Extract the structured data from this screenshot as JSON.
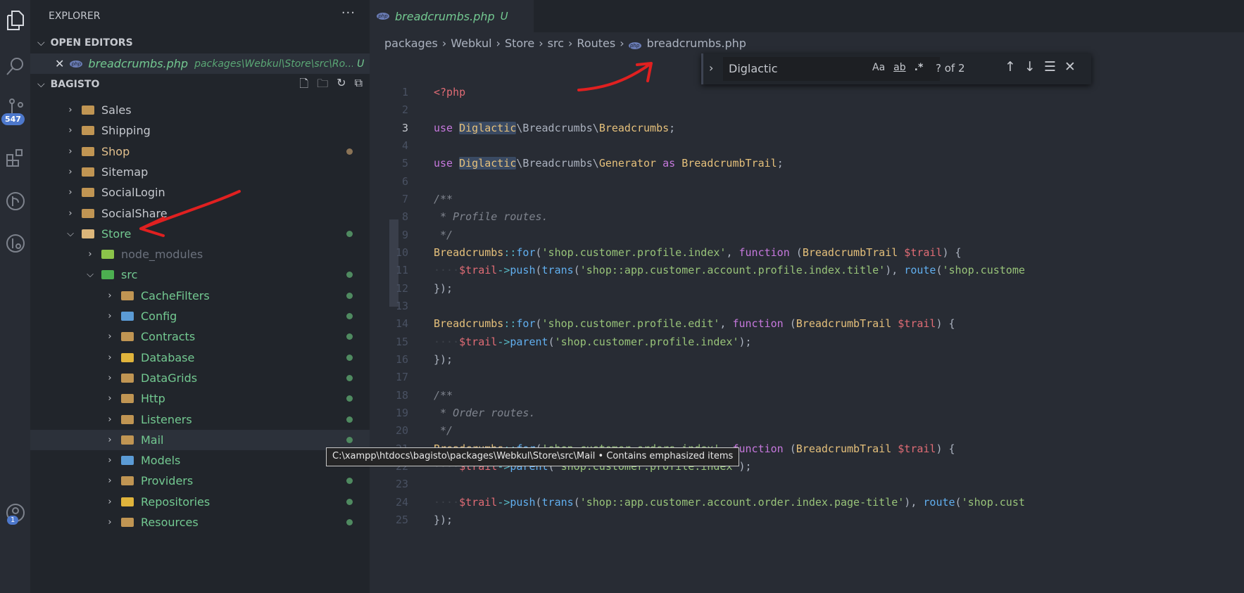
{
  "activity_bar": {
    "items": [
      "files-icon",
      "search-icon",
      "source-control-icon",
      "extensions-icon",
      "git-graph-icon",
      "pull-request-icon",
      "account-icon"
    ],
    "scm_badge": "547",
    "account_badge": "1",
    "accent": "#4d78cc"
  },
  "sidebar": {
    "title": "EXPLORER",
    "more": "···",
    "open_editors": {
      "label": "OPEN EDITORS",
      "file": "breadcrumbs.php",
      "path": "packages\\Webkul\\Store\\src\\Ro...",
      "status": "U"
    },
    "workspace": {
      "label": "BAGISTO",
      "actions": [
        "new-file-icon",
        "new-folder-icon",
        "refresh-icon",
        "collapse-all-icon"
      ]
    },
    "tree": [
      {
        "label": "Sales",
        "level": 0,
        "expanded": false,
        "color": "#c5c8ce",
        "icon": "folder-icon"
      },
      {
        "label": "Shipping",
        "level": 0,
        "expanded": false,
        "color": "#c5c8ce",
        "icon": "folder-icon"
      },
      {
        "label": "Shop",
        "level": 0,
        "expanded": false,
        "color": "#e2c08d",
        "icon": "folder-icon",
        "dot": "#8a7356"
      },
      {
        "label": "Sitemap",
        "level": 0,
        "expanded": false,
        "color": "#c5c8ce",
        "icon": "folder-icon"
      },
      {
        "label": "SocialLogin",
        "level": 0,
        "expanded": false,
        "color": "#c5c8ce",
        "icon": "folder-icon"
      },
      {
        "label": "SocialShare",
        "level": 0,
        "expanded": false,
        "color": "#c5c8ce",
        "icon": "folder-icon"
      },
      {
        "label": "Store",
        "level": 0,
        "expanded": true,
        "color": "#73c991",
        "icon": "folder-open-icon",
        "dot": "#4f8a60"
      },
      {
        "label": "node_modules",
        "level": 1,
        "expanded": false,
        "color": "#6b717d",
        "icon": "node-folder-icon",
        "folder": "#8bc34a"
      },
      {
        "label": "src",
        "level": 1,
        "expanded": true,
        "color": "#73c991",
        "icon": "src-folder-icon",
        "dot": "#4f8a60",
        "folder": "#4caf50"
      },
      {
        "label": "CacheFilters",
        "level": 2,
        "expanded": false,
        "color": "#73c991",
        "icon": "folder-icon",
        "dot": "#4f8a60"
      },
      {
        "label": "Config",
        "level": 2,
        "expanded": false,
        "color": "#73c991",
        "icon": "config-folder-icon",
        "dot": "#4f8a60",
        "folder": "#5b9bd5"
      },
      {
        "label": "Contracts",
        "level": 2,
        "expanded": false,
        "color": "#73c991",
        "icon": "folder-icon",
        "dot": "#4f8a60"
      },
      {
        "label": "Database",
        "level": 2,
        "expanded": false,
        "color": "#73c991",
        "icon": "database-folder-icon",
        "dot": "#4f8a60",
        "folder": "#e0b43c"
      },
      {
        "label": "DataGrids",
        "level": 2,
        "expanded": false,
        "color": "#73c991",
        "icon": "folder-icon",
        "dot": "#4f8a60"
      },
      {
        "label": "Http",
        "level": 2,
        "expanded": false,
        "color": "#73c991",
        "icon": "folder-icon",
        "dot": "#4f8a60"
      },
      {
        "label": "Listeners",
        "level": 2,
        "expanded": false,
        "color": "#73c991",
        "icon": "folder-icon",
        "dot": "#4f8a60"
      },
      {
        "label": "Mail",
        "level": 2,
        "expanded": false,
        "color": "#73c991",
        "icon": "folder-icon",
        "dot": "#4f8a60",
        "hover": true
      },
      {
        "label": "Models",
        "level": 2,
        "expanded": false,
        "color": "#73c991",
        "icon": "models-folder-icon",
        "dot": "#4f8a60",
        "folder": "#5b9bd5"
      },
      {
        "label": "Providers",
        "level": 2,
        "expanded": false,
        "color": "#73c991",
        "icon": "folder-icon",
        "dot": "#4f8a60"
      },
      {
        "label": "Repositories",
        "level": 2,
        "expanded": false,
        "color": "#73c991",
        "icon": "repository-folder-icon",
        "dot": "#4f8a60",
        "folder": "#e0b43c"
      },
      {
        "label": "Resources",
        "level": 2,
        "expanded": false,
        "color": "#73c991",
        "icon": "folder-icon",
        "dot": "#4f8a60"
      }
    ]
  },
  "editor": {
    "tab": {
      "label": "breadcrumbs.php",
      "status": "U"
    },
    "breadcrumb": [
      "packages",
      "Webkul",
      "Store",
      "src",
      "Routes",
      "breadcrumbs.php"
    ],
    "find": {
      "value": "Diglactic",
      "match_case": "Aa",
      "whole_word": "ab",
      "regex": ".*",
      "count": "? of 2"
    },
    "current_line": 3,
    "lines": [
      [
        [
          "v",
          "<?php"
        ]
      ],
      [],
      [
        [
          "k",
          "use "
        ],
        [
          "c match",
          "Diglactic"
        ],
        [
          "p",
          "\\Breadcrumbs\\"
        ],
        [
          "c",
          "Breadcrumbs"
        ],
        [
          "p",
          ";"
        ]
      ],
      [],
      [
        [
          "k",
          "use "
        ],
        [
          "c match",
          "Diglactic"
        ],
        [
          "p",
          "\\Breadcrumbs\\"
        ],
        [
          "c",
          "Generator"
        ],
        [
          "k",
          " as "
        ],
        [
          "c",
          "BreadcrumbTrail"
        ],
        [
          "p",
          ";"
        ]
      ],
      [],
      [
        [
          "cm",
          "/**"
        ]
      ],
      [
        [
          "cm",
          " * Profile routes."
        ]
      ],
      [
        [
          "cm",
          " */"
        ]
      ],
      [
        [
          "c",
          "Breadcrumbs"
        ],
        [
          "o",
          "::"
        ],
        [
          "f",
          "for"
        ],
        [
          "p",
          "("
        ],
        [
          "s",
          "'shop.customer.profile.index'"
        ],
        [
          "p",
          ", "
        ],
        [
          "k",
          "function"
        ],
        [
          "p",
          " ("
        ],
        [
          "c",
          "BreadcrumbTrail"
        ],
        [
          "v",
          " $trail"
        ],
        [
          "p",
          ") {"
        ]
      ],
      [
        [
          "ws",
          "····"
        ],
        [
          "v",
          "$trail"
        ],
        [
          "o",
          "->"
        ],
        [
          "f",
          "push"
        ],
        [
          "p",
          "("
        ],
        [
          "f",
          "trans"
        ],
        [
          "p",
          "("
        ],
        [
          "s",
          "'shop::app.customer.account.profile.index.title'"
        ],
        [
          "p",
          "), "
        ],
        [
          "f",
          "route"
        ],
        [
          "p",
          "("
        ],
        [
          "s",
          "'shop.custome"
        ]
      ],
      [
        [
          "p",
          "});"
        ]
      ],
      [],
      [
        [
          "c",
          "Breadcrumbs"
        ],
        [
          "o",
          "::"
        ],
        [
          "f",
          "for"
        ],
        [
          "p",
          "("
        ],
        [
          "s",
          "'shop.customer.profile.edit'"
        ],
        [
          "p",
          ", "
        ],
        [
          "k",
          "function"
        ],
        [
          "p",
          " ("
        ],
        [
          "c",
          "BreadcrumbTrail"
        ],
        [
          "v",
          " $trail"
        ],
        [
          "p",
          ") {"
        ]
      ],
      [
        [
          "ws",
          "····"
        ],
        [
          "v",
          "$trail"
        ],
        [
          "o",
          "->"
        ],
        [
          "f",
          "parent"
        ],
        [
          "p",
          "("
        ],
        [
          "s",
          "'shop.customer.profile.index'"
        ],
        [
          "p",
          ");"
        ]
      ],
      [
        [
          "p",
          "});"
        ]
      ],
      [],
      [
        [
          "cm",
          "/**"
        ]
      ],
      [
        [
          "cm",
          " * Order routes."
        ]
      ],
      [
        [
          "cm",
          " */"
        ]
      ],
      [
        [
          "c",
          "Breadcrumbs"
        ],
        [
          "o",
          "::"
        ],
        [
          "f",
          "for"
        ],
        [
          "p",
          "("
        ],
        [
          "s",
          "'shop.customer.orders.index'"
        ],
        [
          "p",
          ", "
        ],
        [
          "k",
          "function"
        ],
        [
          "p",
          " ("
        ],
        [
          "c",
          "BreadcrumbTrail"
        ],
        [
          "v",
          " $trail"
        ],
        [
          "p",
          ") {"
        ]
      ],
      [
        [
          "ws",
          "····"
        ],
        [
          "v",
          "$trail"
        ],
        [
          "o",
          "->"
        ],
        [
          "f",
          "parent"
        ],
        [
          "p",
          "("
        ],
        [
          "s",
          "'shop.customer.profile.index'"
        ],
        [
          "p",
          ");"
        ]
      ],
      [],
      [
        [
          "ws",
          "····"
        ],
        [
          "v",
          "$trail"
        ],
        [
          "o",
          "->"
        ],
        [
          "f",
          "push"
        ],
        [
          "p",
          "("
        ],
        [
          "f",
          "trans"
        ],
        [
          "p",
          "("
        ],
        [
          "s",
          "'shop::app.customer.account.order.index.page-title'"
        ],
        [
          "p",
          "), "
        ],
        [
          "f",
          "route"
        ],
        [
          "p",
          "("
        ],
        [
          "s",
          "'shop.cust"
        ]
      ],
      [
        [
          "p",
          "});"
        ]
      ]
    ]
  },
  "tooltip": "C:\\xampp\\htdocs\\bagisto\\packages\\Webkul\\Store\\src\\Mail • Contains emphasized items",
  "annotation_color": "#e02020"
}
